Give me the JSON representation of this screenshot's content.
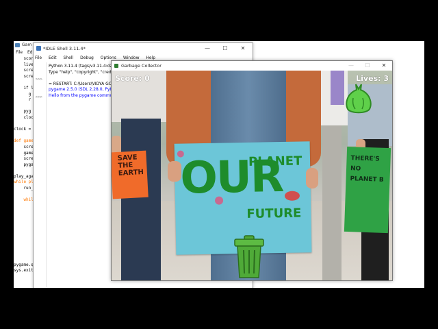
{
  "editor": {
    "title": "Gam",
    "menu": [
      "File",
      "Edit"
    ],
    "code_lines": [
      {
        "text": "    scor",
        "cls": "pl"
      },
      {
        "text": "    live",
        "cls": "pl"
      },
      {
        "text": "    scre",
        "cls": "pl"
      },
      {
        "text": "    scre",
        "cls": "pl"
      },
      {
        "text": "",
        "cls": "pl"
      },
      {
        "text": "    if liv",
        "cls": "pl"
      },
      {
        "text": "      g",
        "cls": "pl"
      },
      {
        "text": "      r",
        "cls": "pl"
      },
      {
        "text": "",
        "cls": "pl"
      },
      {
        "text": "    pyg",
        "cls": "pl"
      },
      {
        "text": "    cloc",
        "cls": "pl"
      },
      {
        "text": "",
        "cls": "pl"
      },
      {
        "text": "clock = py",
        "cls": "pl"
      },
      {
        "text": "",
        "cls": "pl"
      },
      {
        "text": "def game",
        "cls": "kw"
      },
      {
        "text": "    screen",
        "cls": "pl"
      },
      {
        "text": "    game_",
        "cls": "pl"
      },
      {
        "text": "    screen",
        "cls": "pl"
      },
      {
        "text": "    pygam",
        "cls": "pl"
      },
      {
        "text": "",
        "cls": "pl"
      },
      {
        "text": "play_agai",
        "cls": "pl"
      },
      {
        "text": "while play",
        "cls": "kw"
      },
      {
        "text": "    run_ga",
        "cls": "pl"
      },
      {
        "text": "",
        "cls": "pl"
      },
      {
        "text": "    while T",
        "cls": "kw"
      },
      {
        "text": "        pyg",
        "cls": "pl"
      },
      {
        "text": "        time",
        "cls": "pl"
      },
      {
        "text": "        answ",
        "cls": "pl"
      },
      {
        "text": "        if a",
        "cls": "kw"
      },
      {
        "text": "          p",
        "cls": "pl"
      },
      {
        "text": "          b",
        "cls": "pl"
      },
      {
        "text": "        elif",
        "cls": "kw"
      },
      {
        "text": "          p",
        "cls": "pl"
      },
      {
        "text": "          b",
        "cls": "pl"
      },
      {
        "text": "",
        "cls": "pl"
      },
      {
        "text": "pygame.qu",
        "cls": "pl"
      },
      {
        "text": "sys.exit()",
        "cls": "pl"
      }
    ]
  },
  "shell": {
    "title": "*IDLE Shell 3.11.4*",
    "menu": [
      "File",
      "Edit",
      "Shell",
      "Debug",
      "Options",
      "Window",
      "Help"
    ],
    "prompts": [
      ">>>",
      "",
      ">>>"
    ],
    "lines": [
      {
        "text": "Python 3.11.4 (tags/v3.11.4:d2340",
        "cls": "pl"
      },
      {
        "text": "Type \"help\", \"copyright\", \"credits",
        "cls": "pl"
      },
      {
        "text": "",
        "cls": "pl"
      },
      {
        "text": "= RESTART: C:\\Users\\VIDYA GO",
        "cls": "pl"
      },
      {
        "text": "pygame 2.5.0 (SDL 2.28.0, Pytho",
        "cls": "blue"
      },
      {
        "text": "Hello from the pygame commun",
        "cls": "blue"
      }
    ]
  },
  "game": {
    "title": "Garbage Collector",
    "score_label": "Score: 0",
    "lives_label": "Lives: 3",
    "sign_main": {
      "line1": "OUR",
      "line2": "PLANET",
      "line3": "FUTURE"
    },
    "sign_left": "SAVE\nTHE\nEARTH",
    "sign_right": "THERE'S\nNO\nPLANET B",
    "colors": {
      "sign_board": "#6cc6d8",
      "sign_text": "#1e8c2b",
      "bin": "#4faa38",
      "bag": "#5fd04a"
    }
  },
  "window_controls": {
    "minimize": "—",
    "maximize": "☐",
    "close": "✕"
  }
}
